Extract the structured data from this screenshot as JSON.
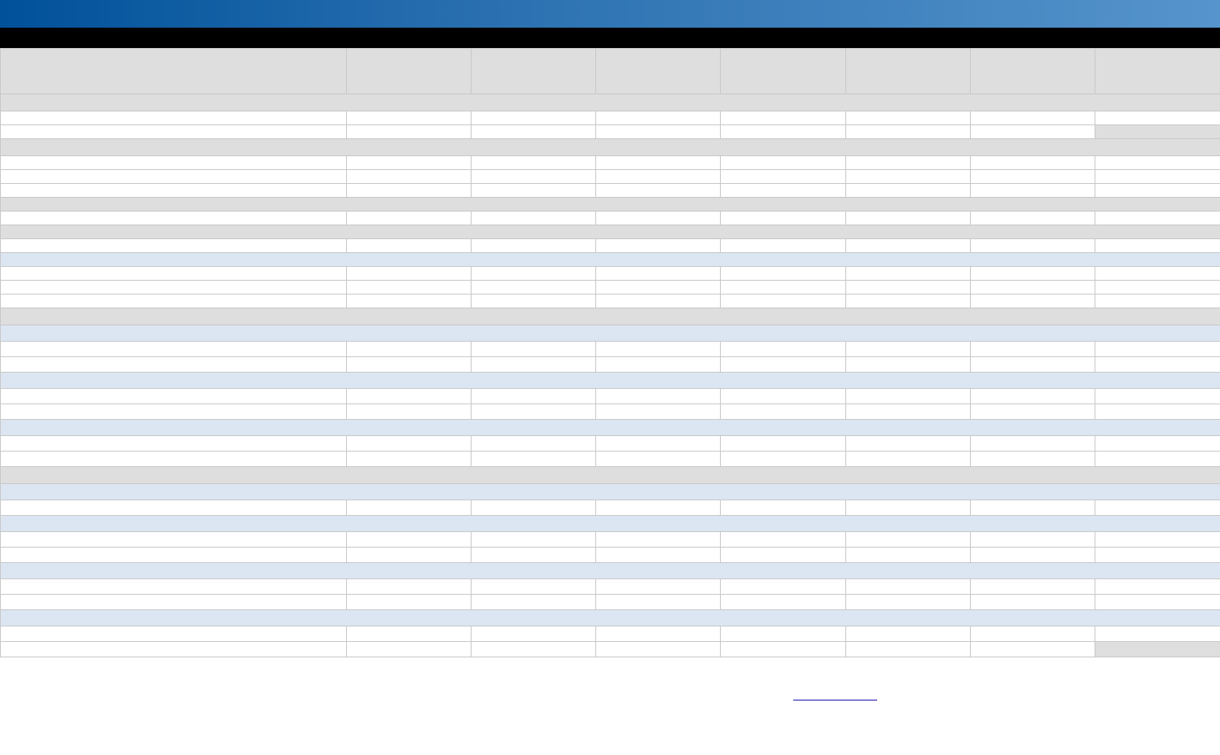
{
  "header": {
    "banner_text": "",
    "subheader_text": ""
  },
  "columns": [
    "",
    "",
    "",
    "",
    "",
    "",
    "",
    ""
  ],
  "rows": [
    {
      "type": "section-gray",
      "h": 21,
      "label": ""
    },
    {
      "type": "data",
      "h": 17,
      "cells": [
        "",
        "",
        "",
        "",
        "",
        "",
        "",
        ""
      ]
    },
    {
      "type": "data",
      "h": 17,
      "cells": [
        "",
        "",
        "",
        "",
        "",
        "",
        "",
        ""
      ],
      "shaded_last": true
    },
    {
      "type": "section-gray",
      "h": 21,
      "label": ""
    },
    {
      "type": "data",
      "h": 17,
      "cells": [
        "",
        "",
        "",
        "",
        "",
        "",
        "",
        ""
      ]
    },
    {
      "type": "data",
      "h": 17,
      "cells": [
        "",
        "",
        "",
        "",
        "",
        "",
        "",
        ""
      ]
    },
    {
      "type": "data",
      "h": 17,
      "cells": [
        "",
        "",
        "",
        "",
        "",
        "",
        "",
        ""
      ]
    },
    {
      "type": "section-gray",
      "h": 17,
      "label": ""
    },
    {
      "type": "data",
      "h": 17,
      "cells": [
        "",
        "",
        "",
        "",
        "",
        "",
        "",
        ""
      ]
    },
    {
      "type": "section-gray",
      "h": 17,
      "label": ""
    },
    {
      "type": "data",
      "h": 17,
      "cells": [
        "",
        "",
        "",
        "",
        "",
        "",
        "",
        ""
      ]
    },
    {
      "type": "section-blue",
      "h": 17,
      "label": ""
    },
    {
      "type": "data",
      "h": 17,
      "cells": [
        "",
        "",
        "",
        "",
        "",
        "",
        "",
        ""
      ]
    },
    {
      "type": "data",
      "h": 17,
      "cells": [
        "",
        "",
        "",
        "",
        "",
        "",
        "",
        ""
      ]
    },
    {
      "type": "data",
      "h": 17,
      "cells": [
        "",
        "",
        "",
        "",
        "",
        "",
        "",
        ""
      ]
    },
    {
      "type": "section-gray",
      "h": 21,
      "label": ""
    },
    {
      "type": "section-blue",
      "h": 20,
      "label": ""
    },
    {
      "type": "data",
      "h": 19,
      "cells": [
        "",
        "",
        "",
        "",
        "",
        "",
        "",
        ""
      ]
    },
    {
      "type": "data",
      "h": 19,
      "cells": [
        "",
        "",
        "",
        "",
        "",
        "",
        "",
        ""
      ]
    },
    {
      "type": "section-blue",
      "h": 20,
      "label": ""
    },
    {
      "type": "data",
      "h": 19,
      "cells": [
        "",
        "",
        "",
        "",
        "",
        "",
        "",
        ""
      ]
    },
    {
      "type": "data",
      "h": 19,
      "cells": [
        "",
        "",
        "",
        "",
        "",
        "",
        "",
        ""
      ]
    },
    {
      "type": "section-blue",
      "h": 20,
      "label": ""
    },
    {
      "type": "data",
      "h": 19,
      "cells": [
        "",
        "",
        "",
        "",
        "",
        "",
        "",
        ""
      ]
    },
    {
      "type": "data",
      "h": 19,
      "cells": [
        "",
        "",
        "",
        "",
        "",
        "",
        "",
        ""
      ]
    },
    {
      "type": "section-gray",
      "h": 21,
      "label": ""
    },
    {
      "type": "section-blue",
      "h": 20,
      "label": ""
    },
    {
      "type": "data",
      "h": 19,
      "cells": [
        "",
        "",
        "",
        "",
        "",
        "",
        "",
        ""
      ]
    },
    {
      "type": "section-blue",
      "h": 20,
      "label": ""
    },
    {
      "type": "data",
      "h": 19,
      "cells": [
        "",
        "",
        "",
        "",
        "",
        "",
        "",
        ""
      ]
    },
    {
      "type": "data",
      "h": 19,
      "cells": [
        "",
        "",
        "",
        "",
        "",
        "",
        "",
        ""
      ]
    },
    {
      "type": "section-blue",
      "h": 20,
      "label": ""
    },
    {
      "type": "data",
      "h": 19,
      "cells": [
        "",
        "",
        "",
        "",
        "",
        "",
        "",
        ""
      ]
    },
    {
      "type": "data",
      "h": 19,
      "cells": [
        "",
        "",
        "",
        "",
        "",
        "",
        "",
        ""
      ]
    },
    {
      "type": "section-blue",
      "h": 20,
      "label": ""
    },
    {
      "type": "data",
      "h": 19,
      "cells": [
        "",
        "",
        "",
        "",
        "",
        "",
        "",
        ""
      ]
    },
    {
      "type": "data",
      "h": 19,
      "cells": [
        "",
        "",
        "",
        "",
        "",
        "",
        "",
        ""
      ],
      "shaded_last": true
    }
  ],
  "footer": {
    "link_text": ""
  }
}
